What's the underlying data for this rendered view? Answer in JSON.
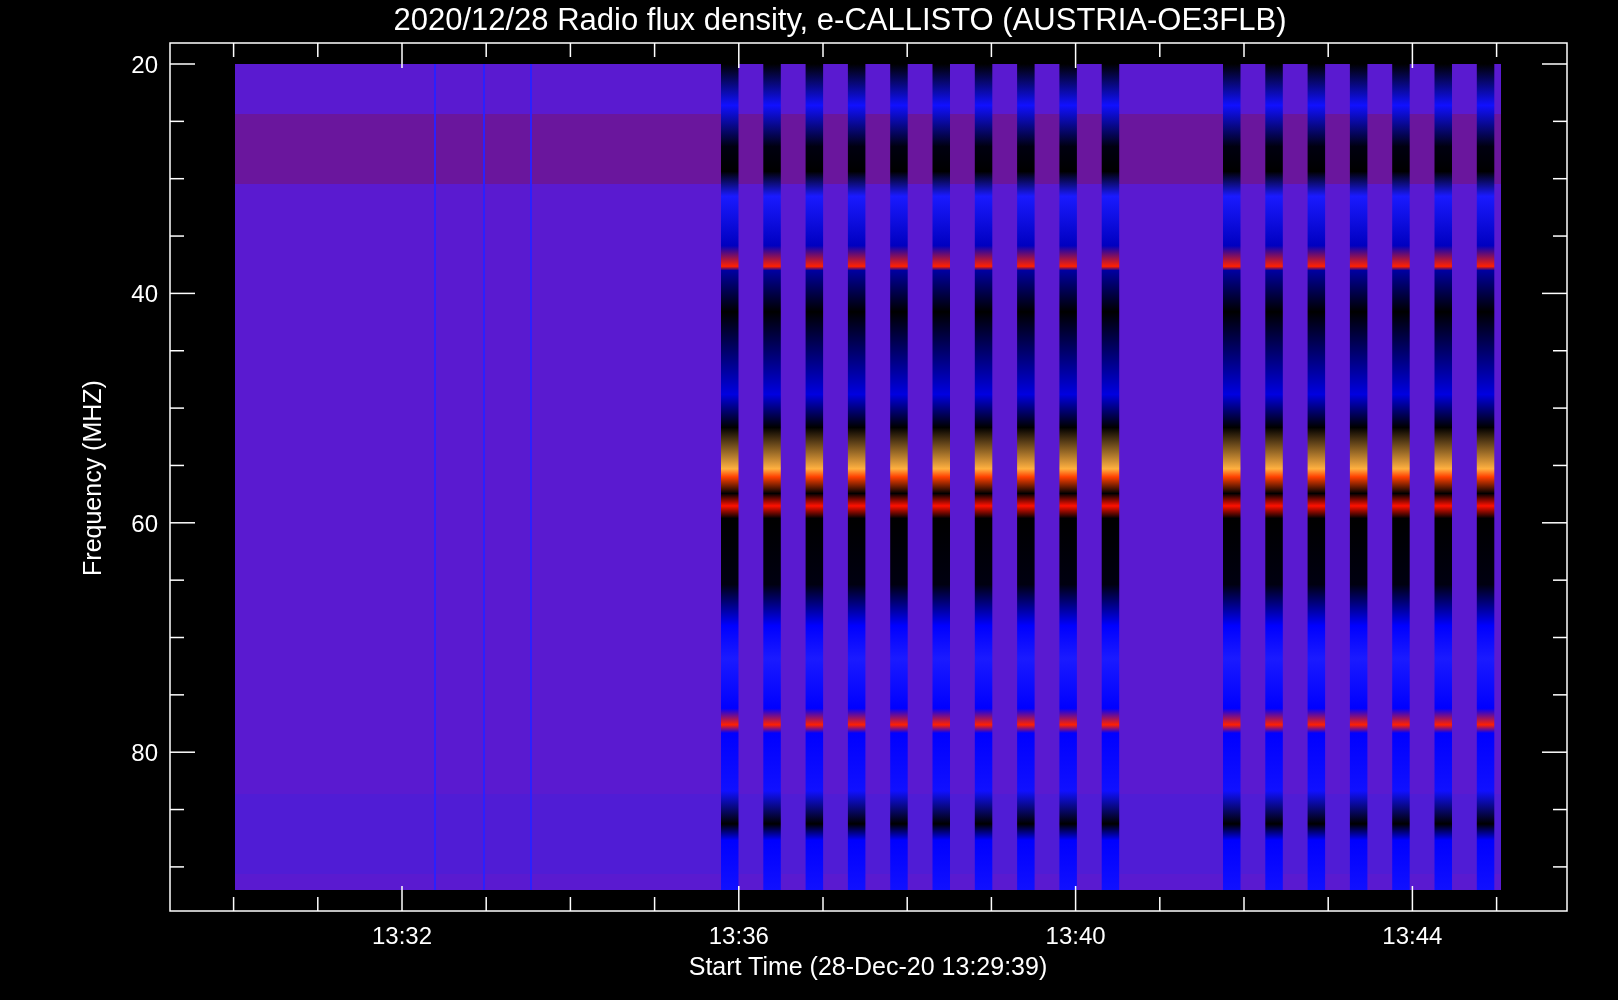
{
  "title": "2020/12/28  Radio flux density, e-CALLISTO (AUSTRIA-OE3FLB)",
  "y_axis": {
    "label": "Frequency (MHZ)",
    "ticks": [
      "20",
      "40",
      "60",
      "80"
    ]
  },
  "x_axis": {
    "label": "Start Time (28-Dec-20 13:29:39)",
    "ticks": [
      "13:32",
      "13:36",
      "13:40",
      "13:44"
    ]
  }
}
